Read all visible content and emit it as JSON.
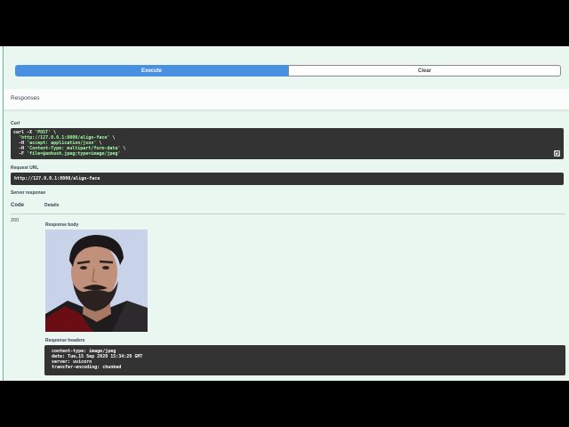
{
  "actions": {
    "execute_label": "Execute",
    "clear_label": "Clear"
  },
  "responses": {
    "title": "Responses"
  },
  "curl": {
    "label": "Curl",
    "lines": [
      {
        "pre": "curl -X ",
        "str": "'POST'",
        "post": " \\"
      },
      {
        "pre": "  ",
        "str": "'http://127.0.0.1:8000/align-face'",
        "post": " \\"
      },
      {
        "pre": "  -H ",
        "str": "'accept: application/json'",
        "post": " \\"
      },
      {
        "pre": "  -H ",
        "str": "'Content-Type: multipart/form-data'",
        "post": " \\"
      },
      {
        "pre": "  -F ",
        "str": "'file=@ankush.jpeg;type=image/jpeg'",
        "post": ""
      }
    ]
  },
  "request_url": {
    "label": "Request URL",
    "value": "http://127.0.0.1:8000/align-face"
  },
  "server_response": {
    "label": "Server response",
    "col_code": "Code",
    "col_details": "Details",
    "code": "200",
    "body_label": "Response body",
    "headers_label": "Response headers",
    "headers": [
      "content-type: image/jpeg",
      "date: Tue,15 Sep 2020 15:34:28 GMT",
      "server: uvicorn",
      "transfer-encoding: chunked"
    ]
  },
  "icons": {
    "copy": "copy-icon"
  },
  "colors": {
    "execute": "#4990e2",
    "panel": "#eaf7f0",
    "code_bg": "#333333",
    "string": "#a2fca2"
  }
}
